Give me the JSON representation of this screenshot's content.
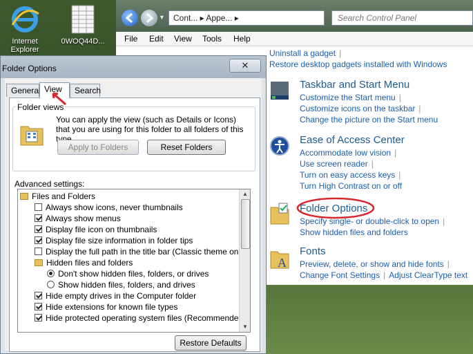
{
  "desktop": {
    "icons": [
      {
        "label": "Internet Explorer",
        "icon": "internet-explorer-icon"
      },
      {
        "label": "0WOQ44D...",
        "icon": "spreadsheet-file-icon"
      }
    ]
  },
  "control_panel": {
    "address": "Cont... ▸ Appe... ▸",
    "search_placeholder": "Search Control Panel",
    "menu": [
      "File",
      "Edit",
      "View",
      "Tools",
      "Help"
    ],
    "sections": [
      {
        "title": "",
        "icon": "gadget-icon",
        "links": [
          "Uninstall a gadget",
          "Restore desktop gadgets installed with Windows"
        ]
      },
      {
        "title": "Taskbar and Start Menu",
        "icon": "taskbar-icon",
        "links": [
          "Customize the Start menu",
          "Customize icons on the taskbar",
          "Change the picture on the Start menu"
        ]
      },
      {
        "title": "Ease of Access Center",
        "icon": "ease-of-access-icon",
        "links": [
          "Accommodate low vision",
          "Use screen reader",
          "Turn on easy access keys",
          "Turn High Contrast on or off"
        ]
      },
      {
        "title": "Folder Options",
        "icon": "folder-options-icon",
        "links": [
          "Specify single- or double-click to open",
          "Show hidden files and folders"
        ]
      },
      {
        "title": "Fonts",
        "icon": "fonts-icon",
        "links": [
          "Preview, delete, or show and hide fonts",
          "Change Font Settings",
          "Adjust ClearType text"
        ]
      }
    ],
    "highlight_color": "#d9262b"
  },
  "folder_options": {
    "title": "Folder Options",
    "close_label": "✕",
    "tabs": [
      "General",
      "View",
      "Search"
    ],
    "active_tab": "View",
    "folder_views": {
      "legend": "Folder views",
      "text": "You can apply the view (such as Details or Icons) that you are using for this folder to all folders of this type.",
      "apply_button": "Apply to Folders",
      "reset_button": "Reset Folders"
    },
    "advanced_label": "Advanced settings:",
    "items": [
      {
        "type": "folder",
        "label": "Files and Folders",
        "indent": 0
      },
      {
        "type": "check",
        "label": "Always show icons, never thumbnails",
        "checked": false,
        "indent": 1
      },
      {
        "type": "check",
        "label": "Always show menus",
        "checked": true,
        "indent": 1
      },
      {
        "type": "check",
        "label": "Display file icon on thumbnails",
        "checked": true,
        "indent": 1
      },
      {
        "type": "check",
        "label": "Display file size information in folder tips",
        "checked": true,
        "indent": 1
      },
      {
        "type": "check",
        "label": "Display the full path in the title bar (Classic theme only)",
        "checked": false,
        "indent": 1
      },
      {
        "type": "folder",
        "label": "Hidden files and folders",
        "indent": 1
      },
      {
        "type": "radio",
        "label": "Don't show hidden files, folders, or drives",
        "checked": true,
        "indent": 2
      },
      {
        "type": "radio",
        "label": "Show hidden files, folders, and drives",
        "checked": false,
        "indent": 2
      },
      {
        "type": "check",
        "label": "Hide empty drives in the Computer folder",
        "checked": true,
        "indent": 1
      },
      {
        "type": "check",
        "label": "Hide extensions for known file types",
        "checked": true,
        "indent": 1
      },
      {
        "type": "check",
        "label": "Hide protected operating system files (Recommended)",
        "checked": true,
        "indent": 1
      }
    ],
    "restore_button": "Restore Defaults"
  }
}
